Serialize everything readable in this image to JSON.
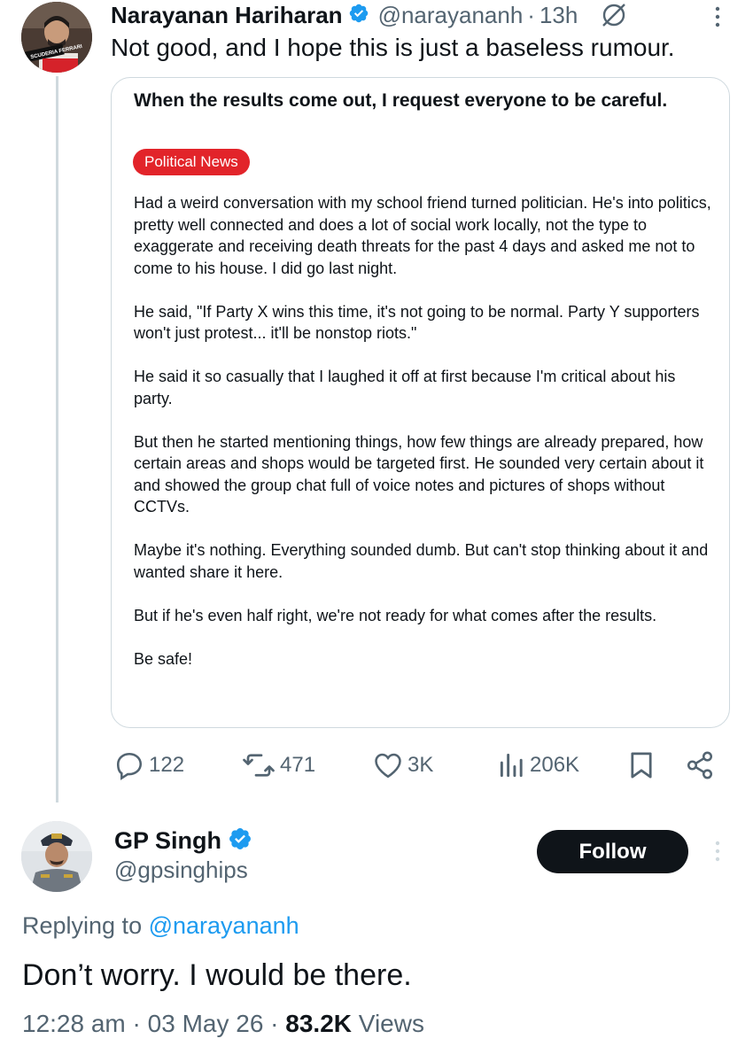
{
  "parent_tweet": {
    "author_name": "Narayanan Hariharan",
    "handle": "@narayananh",
    "separator": "·",
    "time_ago": "13h",
    "text": "Not good, and I hope this is just a baseless rumour.",
    "avatar_caption": "SCUDERIA FERRARI"
  },
  "quote": {
    "title": "When the results come out, I request everyone to be careful.",
    "badge": "Political News",
    "paragraphs": [
      "Had a weird conversation with my school friend turned politician. He's into politics, pretty well connected and does a lot of social work locally, not the type to exaggerate and receiving death threats for the past 4 days and asked me not to come to his house. I did go last night.",
      "He said, \"If Party X wins this time, it's not going to be normal. Party Y supporters won't just protest... it'll be nonstop riots.\"",
      "He said it so casually that I laughed it off at first because I'm critical about his party.",
      "But then he started mentioning things, how few things are already prepared, how certain areas and shops would be targeted first. He sounded very certain about it and showed the group chat full of voice notes and pictures of shops without CCTVs.",
      "Maybe it's nothing. Everything sounded dumb. But can't stop thinking about it and wanted share it here.",
      "But if he's even half right, we're not ready for what comes after the results.",
      "Be safe!"
    ]
  },
  "stats": {
    "replies": "122",
    "reposts": "471",
    "likes": "3K",
    "views": "206K"
  },
  "reply_tweet": {
    "author_name": "GP Singh",
    "handle": "@gpsinghips",
    "follow_label": "Follow",
    "replying_prefix": "Replying to",
    "replying_to": "@narayananh",
    "text": "Don’t worry. I would be there.",
    "time": "12:28 am",
    "date": "03 May 26",
    "separator": "·",
    "views_count": "83.2K",
    "views_label": "Views"
  },
  "colors": {
    "accent": "#1d9bf0",
    "badge": "#e2242a",
    "muted": "#536471",
    "text": "#0f1419"
  }
}
